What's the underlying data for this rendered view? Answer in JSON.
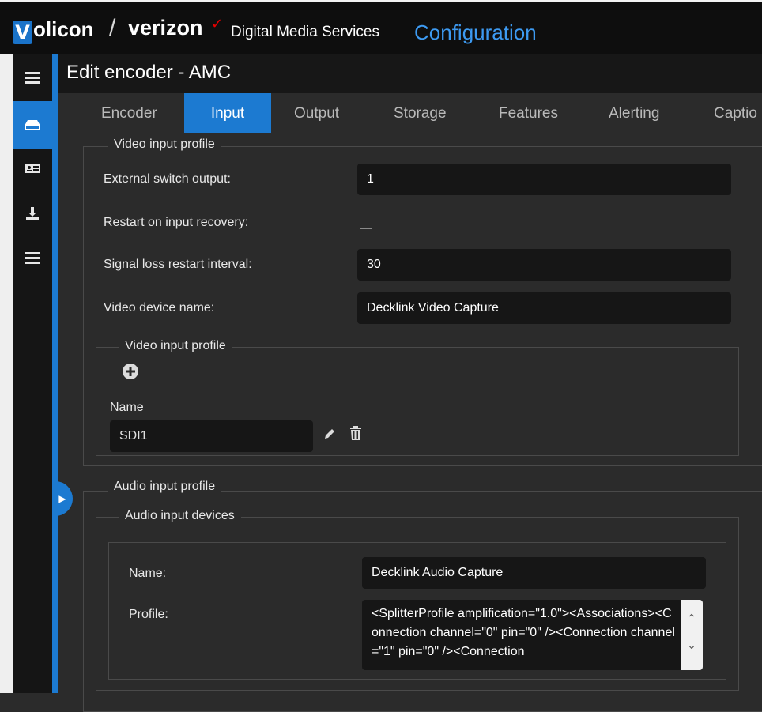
{
  "header": {
    "logo_letter": "V",
    "logo_rest": "olicon",
    "separator": "/",
    "partner": "verizon",
    "partner_check": "✓",
    "product": "Digital Media Services",
    "section": "Configuration"
  },
  "sidebar": {
    "items": [
      {
        "icon": "menu-icon"
      },
      {
        "icon": "encoder-icon",
        "active": true
      },
      {
        "icon": "id-card-icon"
      },
      {
        "icon": "download-icon"
      },
      {
        "icon": "list-icon"
      }
    ]
  },
  "page": {
    "title": "Edit encoder - AMC"
  },
  "tabs": [
    {
      "label": "Encoder"
    },
    {
      "label": "Input",
      "active": true
    },
    {
      "label": "Output"
    },
    {
      "label": "Storage"
    },
    {
      "label": "Features"
    },
    {
      "label": "Alerting"
    },
    {
      "label": "Captio"
    }
  ],
  "video_input_profile": {
    "legend": "Video input profile",
    "external_switch_output": {
      "label": "External switch output:",
      "value": "1"
    },
    "restart_on_input_recovery": {
      "label": "Restart on input recovery:",
      "checked": false
    },
    "signal_loss_restart_interval": {
      "label": "Signal loss restart interval:",
      "value": "30"
    },
    "video_device_name": {
      "label": "Video device name:",
      "value": "Decklink Video Capture"
    },
    "profiles": {
      "legend": "Video input profile",
      "name_label": "Name",
      "name_value": "SDI1"
    }
  },
  "audio_input_profile": {
    "legend": "Audio input profile",
    "devices": {
      "legend": "Audio input devices",
      "name": {
        "label": "Name:",
        "value": "Decklink Audio Capture"
      },
      "profile": {
        "label": "Profile:",
        "value": "<SplitterProfile amplification=\"1.0\"><Associations><Connection channel=\"0\" pin=\"0\" /><Connection channel=\"1\" pin=\"0\" /><Connection"
      }
    }
  },
  "colors": {
    "accent": "#1c7ad1",
    "brand_blue": "#3d9af1",
    "verizon_red": "#e60000",
    "background": "#2b2b2b",
    "input_bg": "#161616"
  }
}
